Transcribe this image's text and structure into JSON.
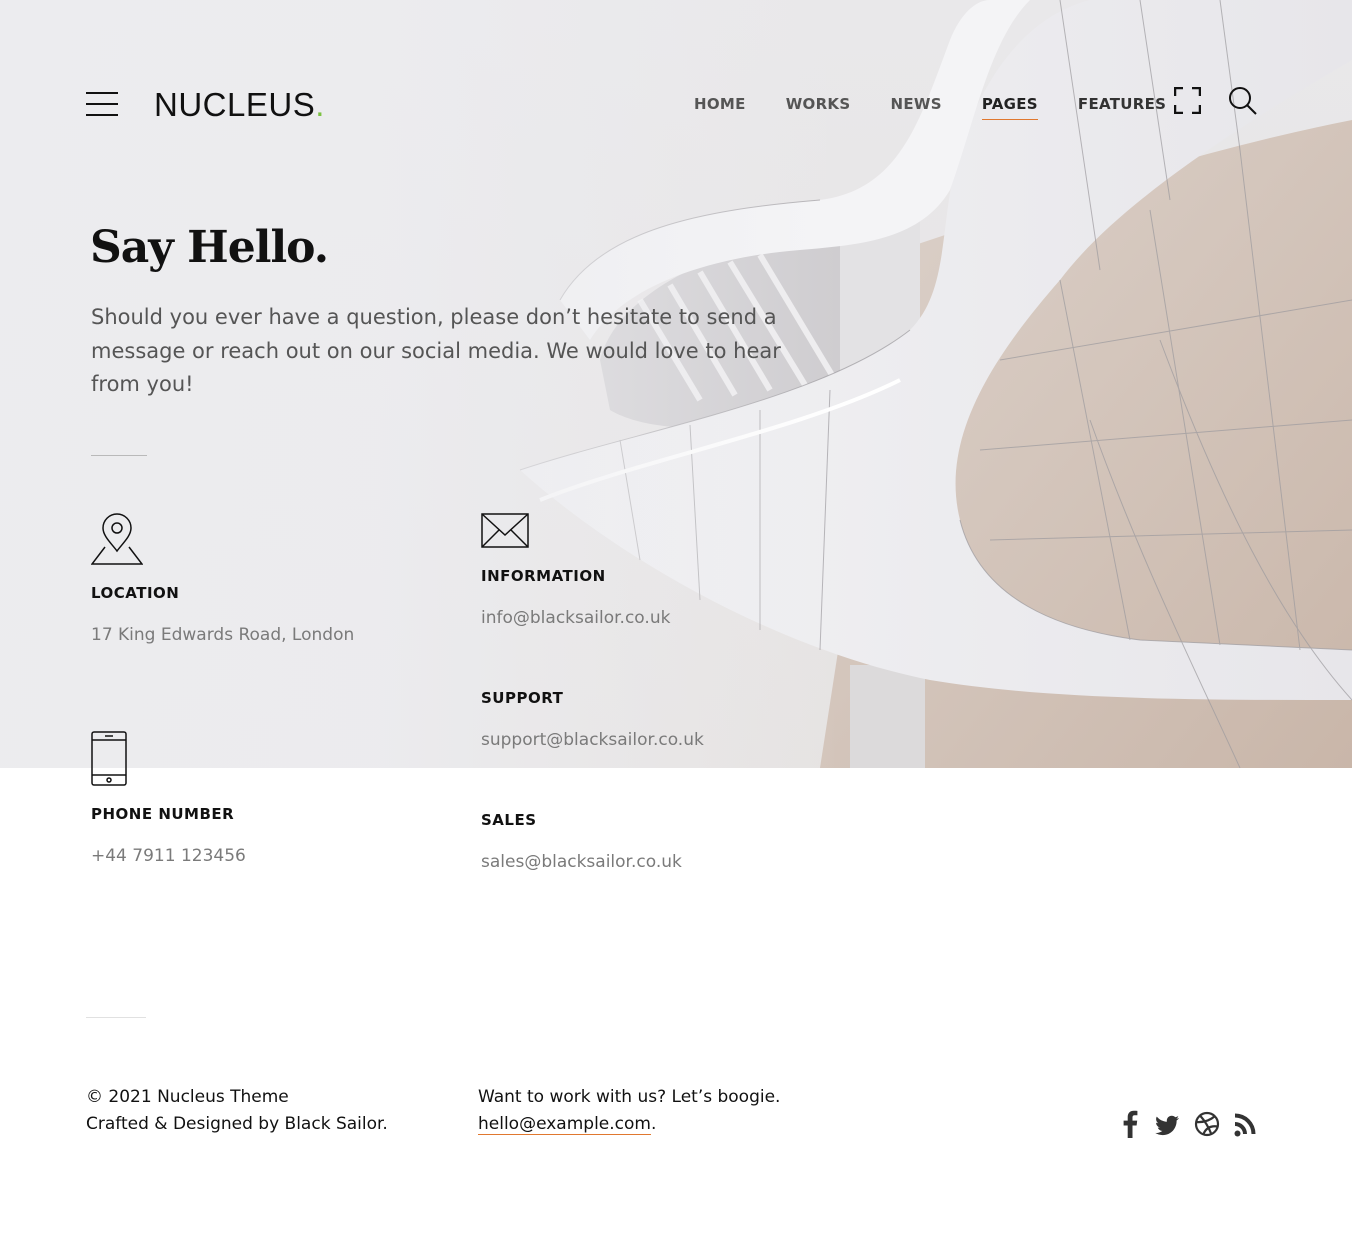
{
  "brand": {
    "name": "NUCLEUS",
    "dot": ".",
    "dot_color": "#7cc242"
  },
  "header": {
    "nav": [
      "HOME",
      "WORKS",
      "NEWS",
      "PAGES",
      "FEATURES"
    ],
    "active_item": "PAGES",
    "icons": [
      "menu-icon",
      "fullscreen-icon",
      "search-icon"
    ]
  },
  "intro": {
    "title": "Say Hello.",
    "text": "Should you ever have a question, please don’t hesitate to send a message or reach out on our social media. We would love to hear from you!"
  },
  "contact": {
    "location": {
      "icon": "map-pin-icon",
      "heading": "LOCATION",
      "value": "17 King Edwards Road, London"
    },
    "phone": {
      "icon": "mobile-phone-icon",
      "heading": "PHONE NUMBER",
      "value": "+44 7911 123456"
    },
    "information": {
      "icon": "envelope-icon",
      "heading": "INFORMATION",
      "value": "info@blacksailor.co.uk"
    },
    "support": {
      "heading": "SUPPORT",
      "value": "support@blacksailor.co.uk"
    },
    "sales": {
      "heading": "SALES",
      "value": "sales@blacksailor.co.uk"
    }
  },
  "footer": {
    "copyright": "© 2021 Nucleus Theme",
    "credit": "Crafted & Designed by Black Sailor.",
    "cta": "Want to work with us? Let’s boogie.",
    "email": "hello@example.com",
    "email_suffix": ".",
    "social": [
      "facebook-icon",
      "twitter-icon",
      "dribbble-icon",
      "rss-icon"
    ]
  },
  "colors": {
    "accent": "#e0782f",
    "text": "#111111",
    "muted": "#7a7a7a"
  }
}
